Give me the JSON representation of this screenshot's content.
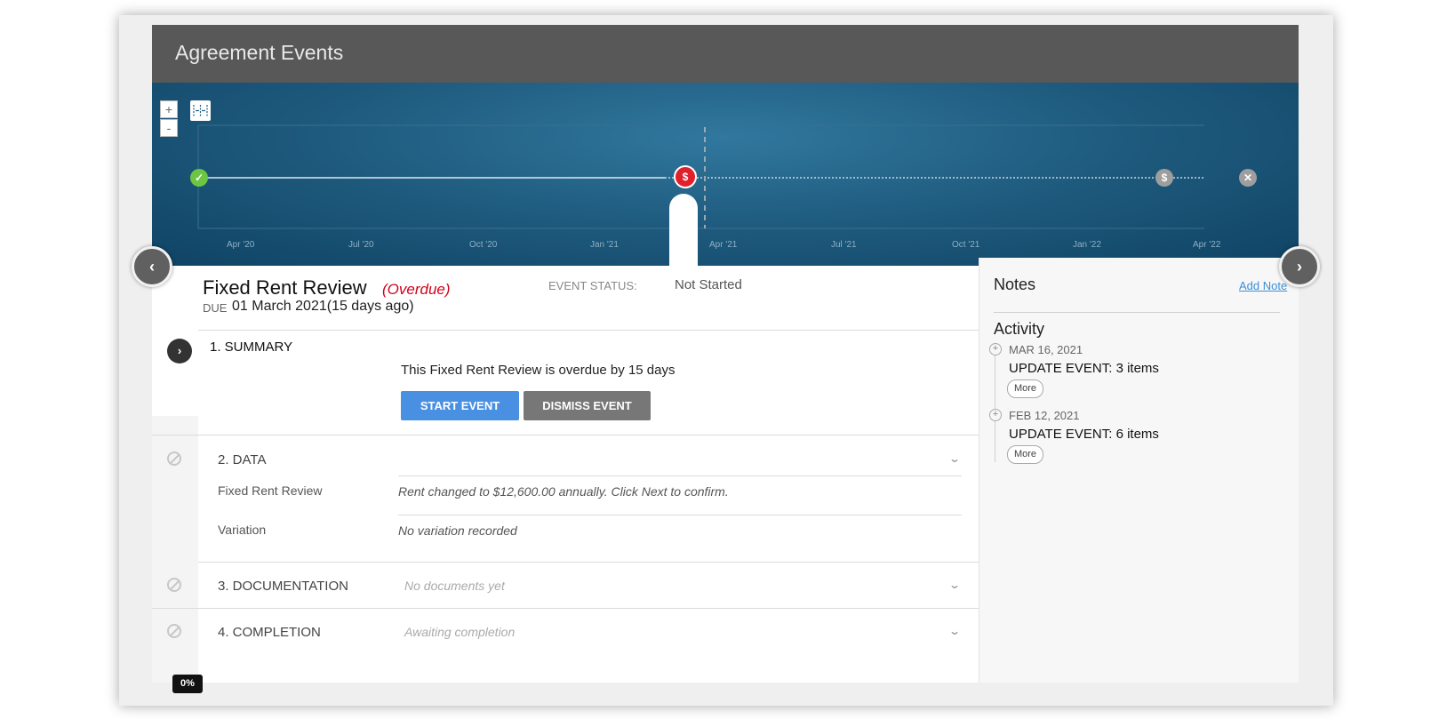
{
  "header": {
    "title": "Agreement Events"
  },
  "timeline": {
    "zoom_in": "+",
    "zoom_out": "-",
    "ticks": [
      "Apr '20",
      "Jul '20",
      "Oct '20",
      "Jan '21",
      "Apr '21",
      "Jul '21",
      "Oct '21",
      "Jan '22",
      "Apr '22"
    ],
    "markers": [
      {
        "icon": "check-icon",
        "glyph": "✓",
        "status": "completed",
        "color": "#6cc644"
      },
      {
        "icon": "dollar-icon",
        "glyph": "$",
        "status": "overdue",
        "color": "#e0202a"
      },
      {
        "icon": "dollar-icon",
        "glyph": "$",
        "status": "future",
        "color": "#9e9e9e"
      },
      {
        "icon": "close-icon",
        "glyph": "✕",
        "status": "end",
        "color": "#9e9e9e"
      }
    ]
  },
  "navigation": {
    "prev": "‹",
    "next": "›"
  },
  "event": {
    "title": "Fixed Rent Review",
    "overdue_label": "(Overdue)",
    "due_label": "DUE",
    "due_date": "01 March 2021(15 days ago)",
    "status_label": "EVENT STATUS:",
    "status_value": "Not Started"
  },
  "sections": {
    "summary": {
      "title": "1. SUMMARY",
      "text": "This Fixed Rent Review is overdue by 15 days",
      "start_button": "START EVENT",
      "dismiss_button": "DISMISS EVENT",
      "expand_glyph": "›"
    },
    "data": {
      "title": "2. DATA",
      "rows": [
        {
          "label": "Fixed Rent Review",
          "value": "Rent changed to $12,600.00 annually. Click Next to confirm."
        },
        {
          "label": "Variation",
          "value": "No variation recorded"
        }
      ]
    },
    "documentation": {
      "title": "3. DOCUMENTATION",
      "value": "No documents yet"
    },
    "completion": {
      "title": "4. COMPLETION",
      "value": "Awaiting completion"
    },
    "chevron": "⌄"
  },
  "notes": {
    "title": "Notes",
    "add_note": "Add Note",
    "activity_title": "Activity",
    "activities": [
      {
        "date": "MAR 16, 2021",
        "text": "UPDATE EVENT: 3 items",
        "more": "More"
      },
      {
        "date": "FEB 12, 2021",
        "text": "UPDATE EVENT: 6 items",
        "more": "More"
      }
    ],
    "plus": "+"
  },
  "progress": {
    "label": "0%",
    "value": 0
  }
}
